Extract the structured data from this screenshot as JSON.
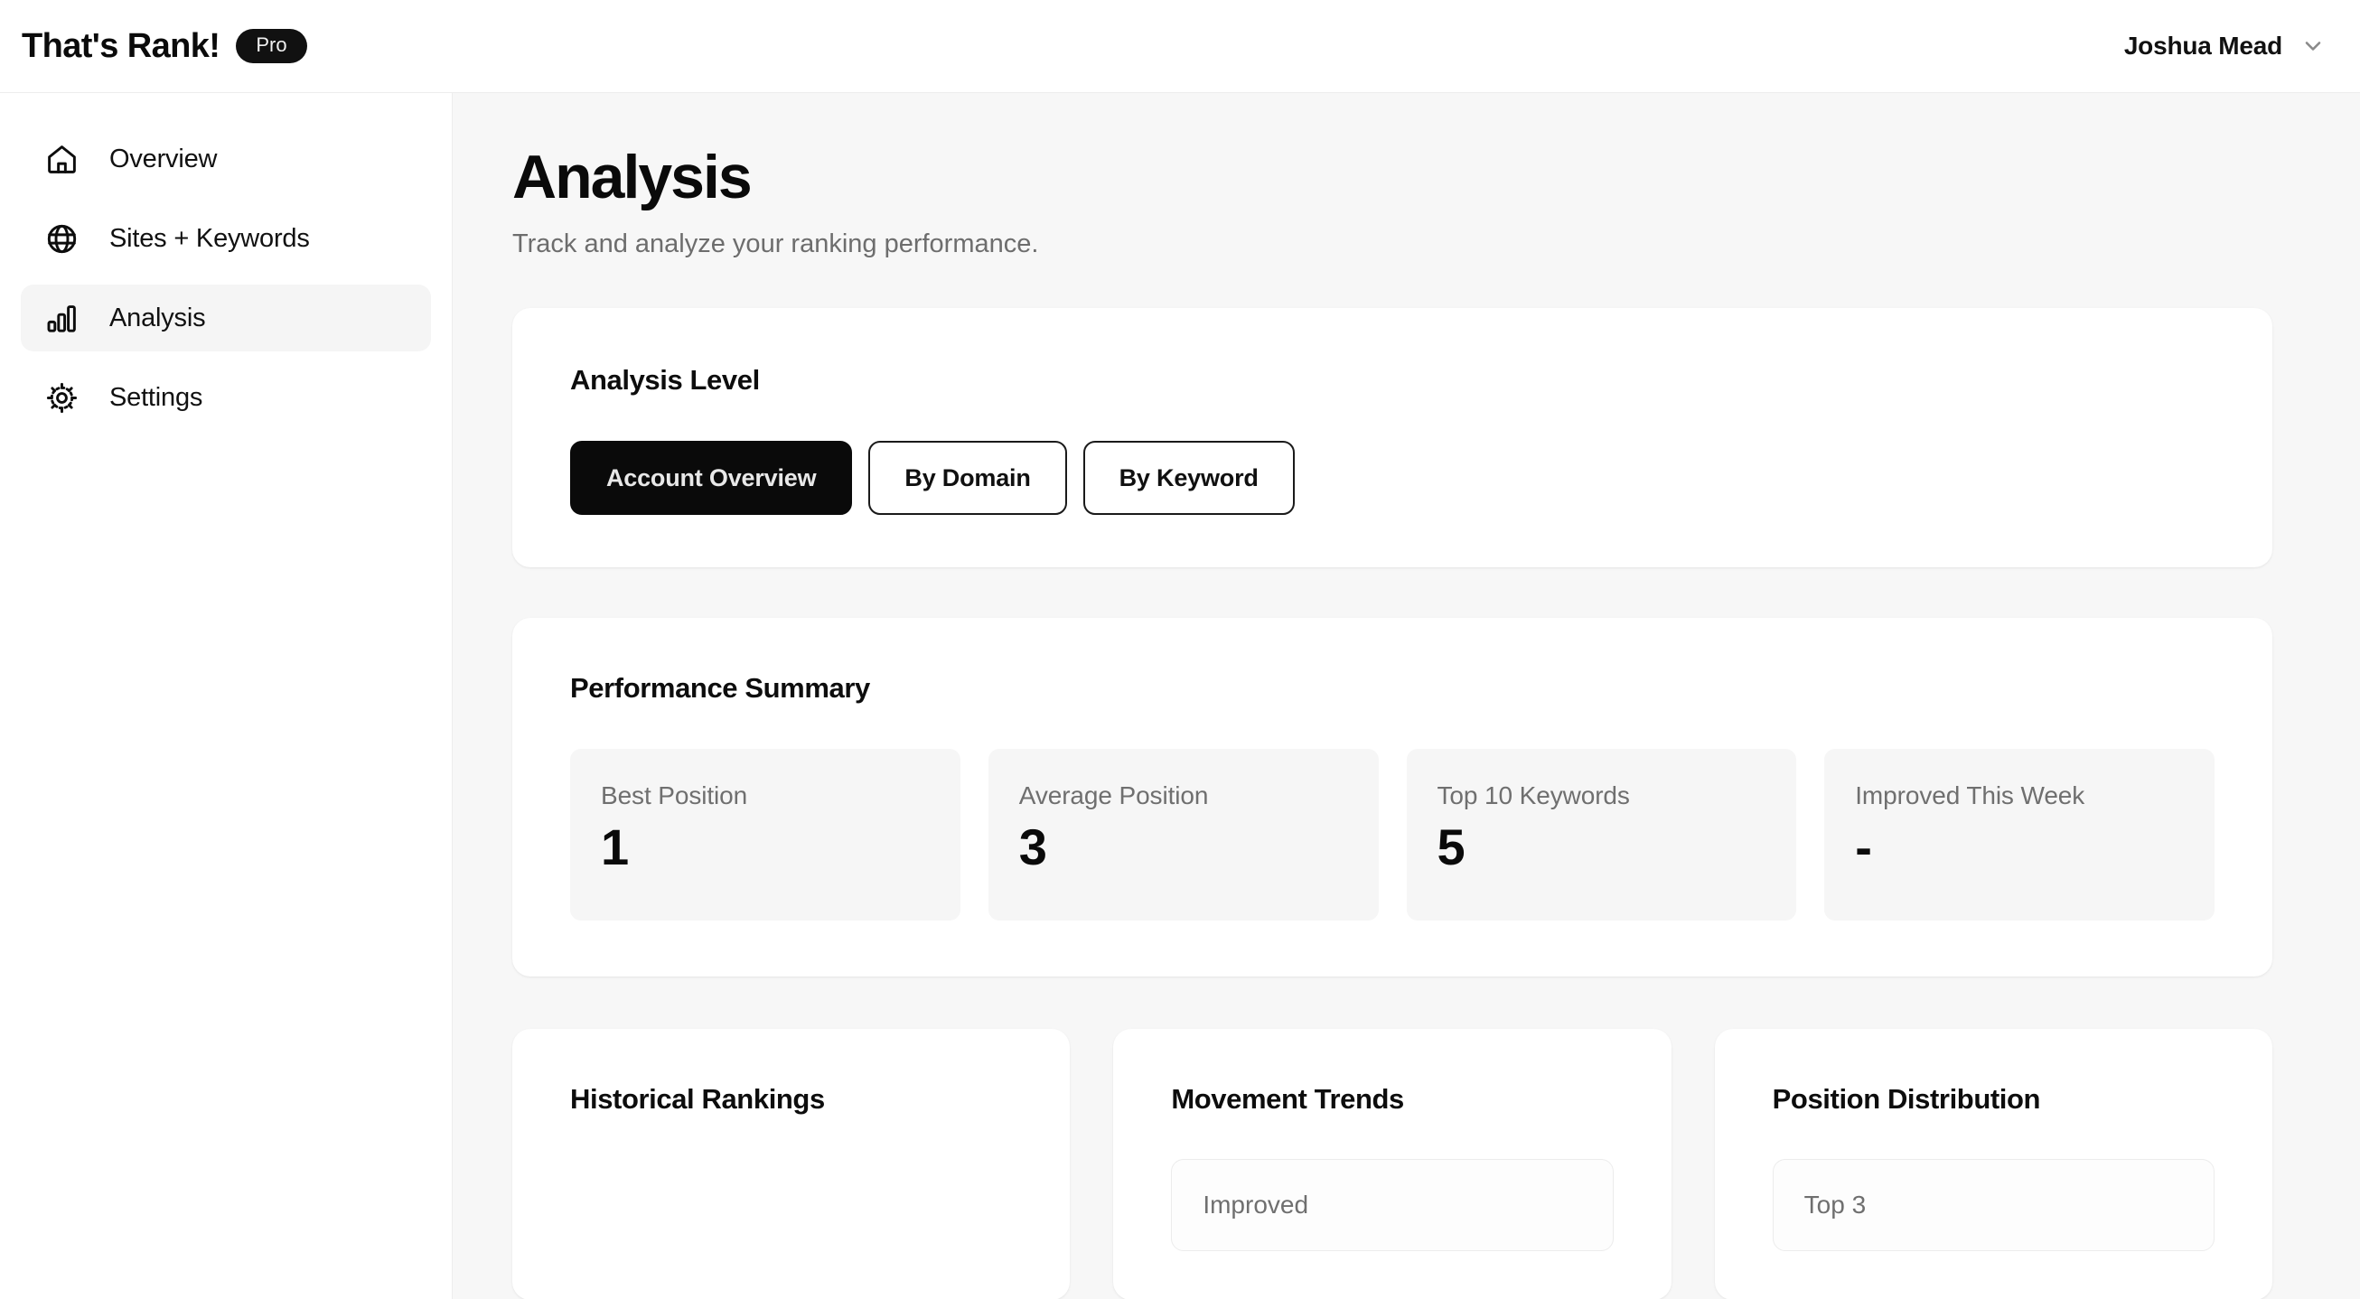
{
  "topbar": {
    "brand_title": "That's Rank!",
    "pro_badge": "Pro",
    "user_name": "Joshua Mead"
  },
  "sidebar": {
    "items": [
      {
        "label": "Overview",
        "icon": "home-icon",
        "active": false
      },
      {
        "label": "Sites + Keywords",
        "icon": "globe-icon",
        "active": false
      },
      {
        "label": "Analysis",
        "icon": "bar-chart-icon",
        "active": true
      },
      {
        "label": "Settings",
        "icon": "gear-icon",
        "active": false
      }
    ]
  },
  "page": {
    "title": "Analysis",
    "subtitle": "Track and analyze your ranking performance."
  },
  "analysis_level": {
    "title": "Analysis Level",
    "options": [
      {
        "label": "Account Overview",
        "selected": true
      },
      {
        "label": "By Domain",
        "selected": false
      },
      {
        "label": "By Keyword",
        "selected": false
      }
    ]
  },
  "performance_summary": {
    "title": "Performance Summary",
    "stats": [
      {
        "label": "Best Position",
        "value": "1"
      },
      {
        "label": "Average Position",
        "value": "3"
      },
      {
        "label": "Top 10 Keywords",
        "value": "5"
      },
      {
        "label": "Improved This Week",
        "value": "-"
      }
    ]
  },
  "bottom_cards": [
    {
      "title": "Historical Rankings",
      "sub_label": ""
    },
    {
      "title": "Movement Trends",
      "sub_label": "Improved"
    },
    {
      "title": "Position Distribution",
      "sub_label": "Top 3"
    }
  ],
  "colors": {
    "accent": "#0a0a0a",
    "page_bg": "#f7f7f7",
    "card_bg": "#ffffff",
    "stat_bg": "#f6f6f6",
    "muted_text": "#6f6f6f"
  }
}
